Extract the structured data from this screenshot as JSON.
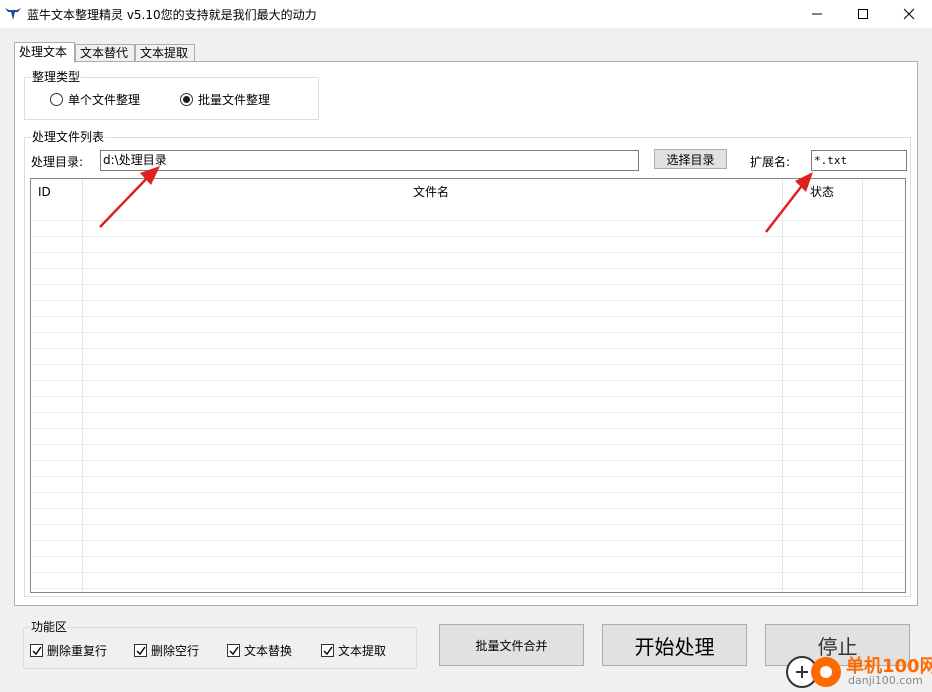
{
  "window": {
    "title": "蓝牛文本整理精灵 v5.10您的支持就是我们最大的动力",
    "icon": "bull-icon",
    "controls": [
      "minimize-icon",
      "maximize-icon",
      "close-icon"
    ]
  },
  "tabs": [
    {
      "label": "处理文本",
      "active": true
    },
    {
      "label": "文本替代",
      "active": false
    },
    {
      "label": "文本提取",
      "active": false
    }
  ],
  "type_group": {
    "legend": "整理类型",
    "options": [
      {
        "label": "单个文件整理",
        "selected": false
      },
      {
        "label": "批量文件整理",
        "selected": true
      }
    ]
  },
  "file_group": {
    "legend": "处理文件列表",
    "dir_label": "处理目录:",
    "dir_value": "d:\\处理目录",
    "select_dir_button": "选择目录",
    "ext_label": "扩展名:",
    "ext_value": "*.txt",
    "columns": [
      "ID",
      "文件名",
      "状态"
    ]
  },
  "function_group": {
    "legend": "功能区",
    "checks": [
      {
        "label": "删除重复行",
        "checked": true
      },
      {
        "label": "删除空行",
        "checked": true
      },
      {
        "label": "文本替换",
        "checked": true
      },
      {
        "label": "文本提取",
        "checked": true
      }
    ]
  },
  "buttons": {
    "merge": "批量文件合并",
    "start": "开始处理",
    "stop": "停止"
  },
  "watermark": {
    "name": "单机100网",
    "url": "danji100.com"
  },
  "colors": {
    "arrow": "#e02020",
    "watermark": "#ff6a00"
  }
}
